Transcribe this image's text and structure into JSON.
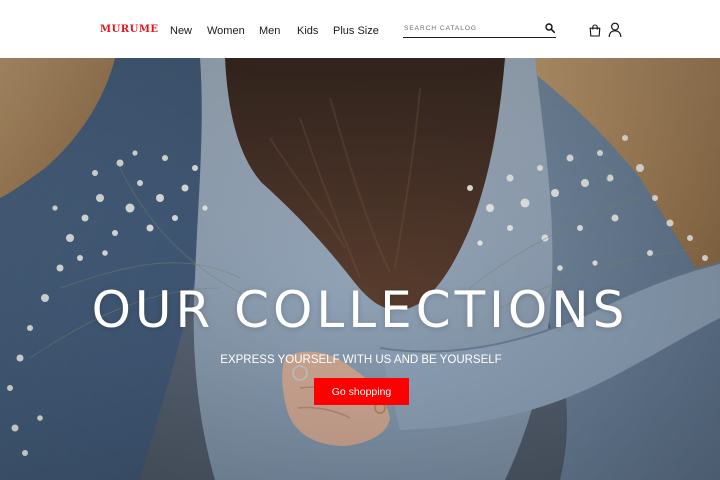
{
  "brand": {
    "logo_text": "MURUME",
    "logo_color": "#e8141b"
  },
  "nav": {
    "items": [
      {
        "label": "New"
      },
      {
        "label": "Women"
      },
      {
        "label": "Men"
      },
      {
        "label": "Kids"
      },
      {
        "label": "Plus Size"
      }
    ]
  },
  "search": {
    "placeholder": "SEARCH CATALOG",
    "value": "",
    "icon": "search-icon"
  },
  "header_icons": {
    "cart": "shopping-bag-icon",
    "account": "user-icon"
  },
  "hero": {
    "title": "OUR COLLECTIONS",
    "subtitle": "EXPRESS YOURSELF WITH US AND BE YOURSELF",
    "cta_label": "Go shopping",
    "cta_color": "#ff0000",
    "image": "three people in denim jackets holding baby's breath flowers"
  }
}
